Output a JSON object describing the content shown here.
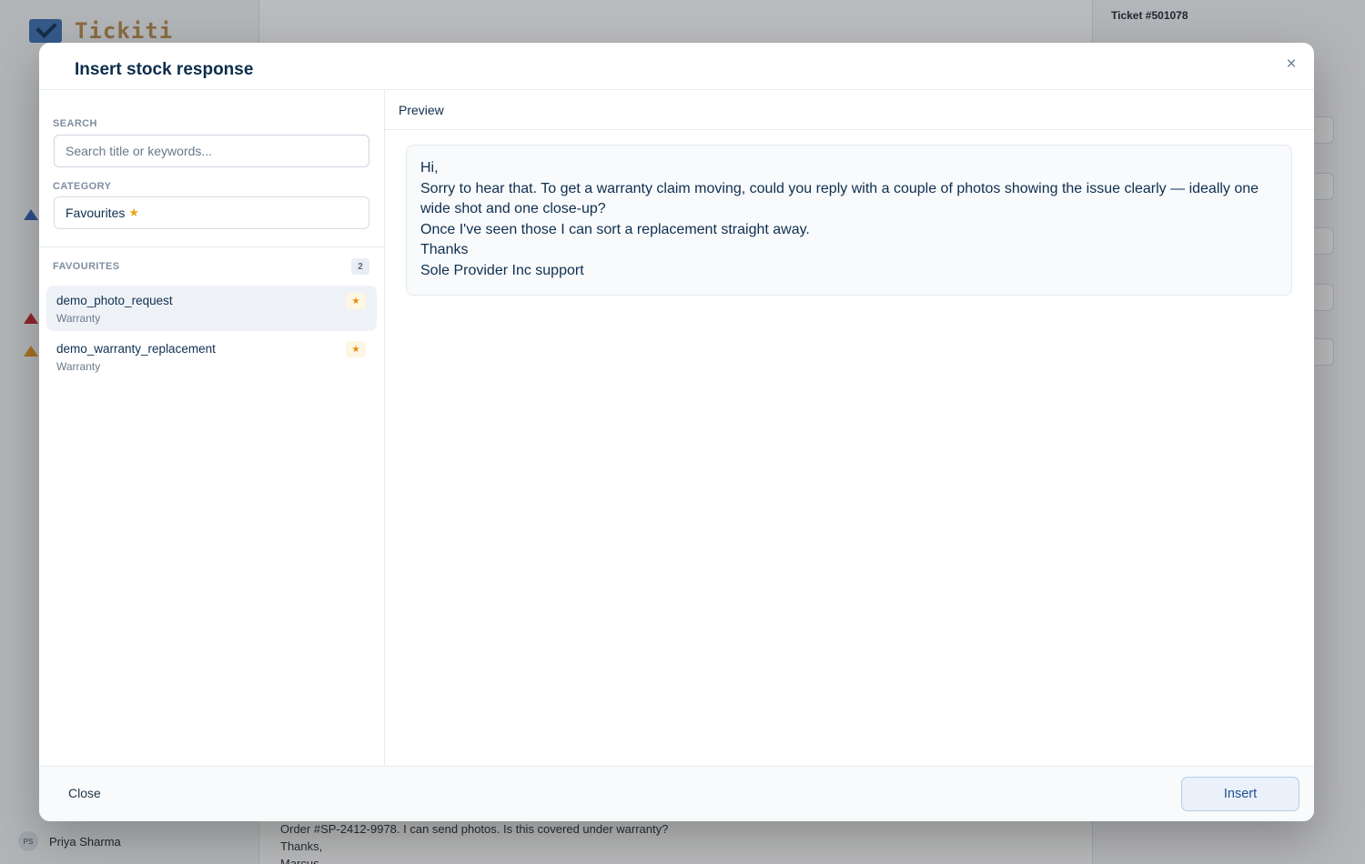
{
  "app": {
    "logo_text": "Tickiti",
    "ticket_label": "Ticket #501078",
    "user_name": "Priya Sharma",
    "user_initials": "PS",
    "background_message": [
      "Order #SP-2412-9978. I can send photos. Is this covered under warranty?",
      "Thanks,",
      "Marcus"
    ]
  },
  "modal": {
    "title": "Insert stock response",
    "close_icon": "×"
  },
  "search": {
    "label": "SEARCH",
    "placeholder": "Search title or keywords...",
    "value": ""
  },
  "category": {
    "label": "CATEGORY",
    "selected": "Favourites",
    "icon": "star-icon"
  },
  "favourites": {
    "heading": "FAVOURITES",
    "count": "2",
    "items": [
      {
        "title": "demo_photo_request",
        "category": "Warranty",
        "starred": true
      },
      {
        "title": "demo_warranty_replacement",
        "category": "Warranty",
        "starred": true
      }
    ]
  },
  "preview": {
    "label": "Preview",
    "lines": [
      "Hi,",
      "Sorry to hear that. To get a warranty claim moving, could you reply with a couple of photos showing the issue clearly — ideally one wide shot and one close-up?",
      "Once I've seen those I can sort a replacement straight away.",
      "Thanks",
      "Sole Provider Inc support"
    ]
  },
  "footer": {
    "close_label": "Close",
    "insert_label": "Insert"
  },
  "colors": {
    "accent": "#1d4f8f",
    "star": "#e8a618",
    "title": "#0d2d4d"
  }
}
